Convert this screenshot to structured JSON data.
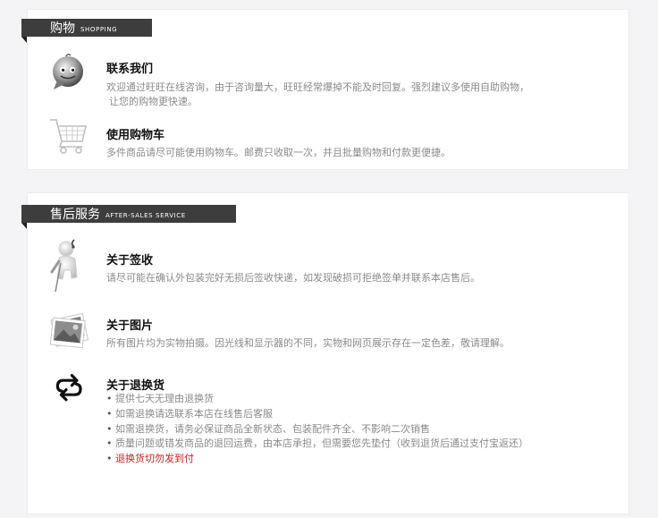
{
  "shopping": {
    "title_zh": "购物",
    "title_en": "SHOPPING",
    "items": [
      {
        "icon": "wangwang-chat-icon",
        "title": "联系我们",
        "desc": [
          "欢迎通过旺旺在线咨询，由于咨询量大，旺旺经常爆掉不能及时回复。强烈建议多使用自助购物，",
          "让您的购物更快速。"
        ]
      },
      {
        "icon": "shopping-cart-icon",
        "title": "使用购物车",
        "desc": [
          "多件商品请尽可能使用购物车。邮费只收取一次，并且批量购物和付款更便捷。"
        ]
      }
    ]
  },
  "after_sales": {
    "title_zh": "售后服务",
    "title_en": "AFTER-SALES SERVICE",
    "items": [
      {
        "icon": "figure-signing-icon",
        "title": "关于签收",
        "desc": "请尽可能在确认外包装完好无损后签收快递，如发现破损可拒绝签单并联系本店售后。"
      },
      {
        "icon": "photo-stack-icon",
        "title": "关于图片",
        "desc": "所有图片均为实物拍摄。因光线和显示器的不同，实物和网页展示存在一定色差，敬请理解。"
      },
      {
        "icon": "exchange-arrows-icon",
        "title": "关于退换货",
        "rules": [
          "提供七天无理由退换货",
          "如需退换请选联系本店在线售后客服",
          "如需退换货，请务必保证商品全新状态、包装配件齐全、不影响二次销售",
          "质量问题或错发商品的退回运费，由本店承担，但需要您先垫付（收到退货后通过支付宝返还）",
          "退换货切勿发到付"
        ]
      }
    ]
  },
  "colors": {
    "section_bar": "#3d3d3d",
    "desc_text": "#8a8a8a",
    "warning": "#cc2222"
  }
}
